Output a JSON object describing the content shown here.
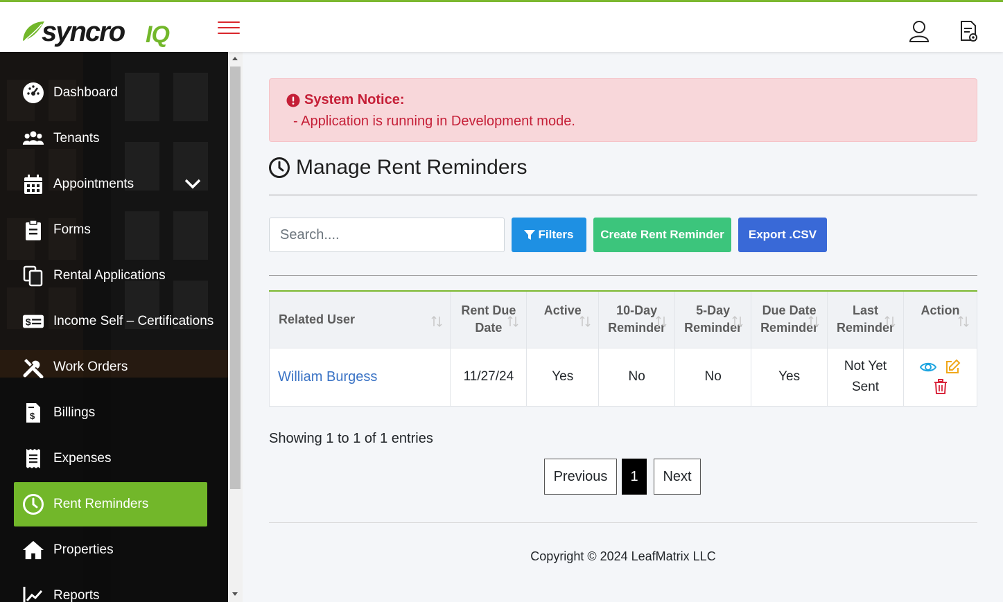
{
  "brand": {
    "logo_text_main": "syncro",
    "logo_text_accent": "IQ",
    "accent_color": "#72b72a",
    "logo_text_color": "#1a1a1a"
  },
  "header": {
    "menu_icon": "hamburger-icon",
    "profile_icon": "user-icon",
    "doc_icon": "document-settings-icon"
  },
  "sidebar": {
    "items": [
      {
        "label": "Dashboard",
        "icon": "dashboard-icon"
      },
      {
        "label": "Tenants",
        "icon": "users-icon"
      },
      {
        "label": "Appointments",
        "icon": "calendar-icon"
      },
      {
        "label": "Forms",
        "icon": "clipboard-icon"
      },
      {
        "label": "Rental Applications",
        "icon": "copy-icon"
      },
      {
        "label": "Income Self – Certifications",
        "icon": "money-icon"
      },
      {
        "label": "Work Orders",
        "icon": "tools-icon"
      },
      {
        "label": "Billings",
        "icon": "invoice-icon"
      },
      {
        "label": "Expenses",
        "icon": "receipt-icon"
      },
      {
        "label": "Rent Reminders",
        "icon": "clock-icon"
      },
      {
        "label": "Properties",
        "icon": "home-icon"
      },
      {
        "label": "Reports",
        "icon": "chart-line-icon"
      }
    ],
    "active": "Rent Reminders"
  },
  "notice": {
    "title": "System Notice:",
    "message": "- Application is running in Development mode."
  },
  "page": {
    "title": "Manage Rent Reminders"
  },
  "toolbar": {
    "search_placeholder": "Search....",
    "filters_label": "Filters",
    "create_label": "Create Rent Reminder",
    "export_label": "Export .CSV"
  },
  "table": {
    "headers": {
      "related_user": "Related User",
      "rent_due_1": "Rent Due",
      "rent_due_2": "Date",
      "active": "Active",
      "ten_day_1": "10-Day",
      "ten_day_2": "Reminder",
      "five_day_1": "5-Day",
      "five_day_2": "Reminder",
      "due_date_1": "Due Date",
      "due_date_2": "Reminder",
      "last_1": "Last",
      "last_2": "Reminder",
      "action": "Action"
    },
    "rows": [
      {
        "related_user": "William Burgess",
        "rent_due_date": "11/27/24",
        "active": "Yes",
        "ten_day": "No",
        "five_day": "No",
        "due_date": "Yes",
        "last_1": "Not Yet",
        "last_2": "Sent"
      }
    ]
  },
  "pagination": {
    "info": "Showing 1 to 1 of 1 entries",
    "previous": "Previous",
    "current": "1",
    "next": "Next"
  },
  "footer": {
    "copyright": "Copyright © 2024 LeafMatrix LLC"
  }
}
